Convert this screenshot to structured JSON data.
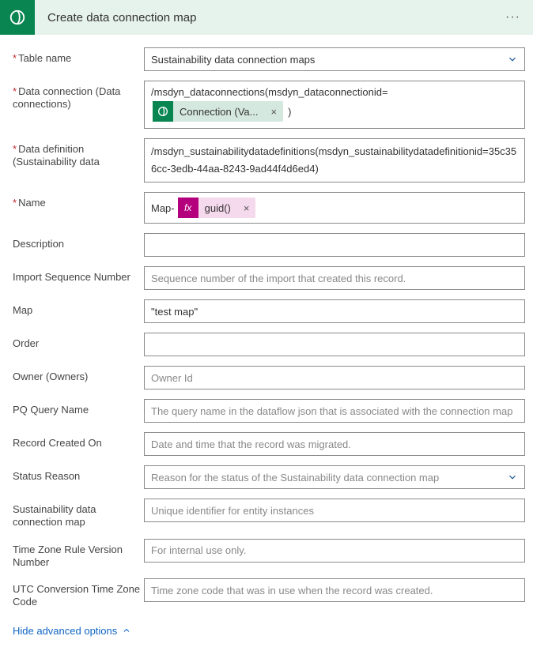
{
  "header": {
    "title": "Create data connection map"
  },
  "fields": {
    "table_name": {
      "label": "Table name",
      "value": "Sustainability data connection maps"
    },
    "data_connection": {
      "label": "Data connection (Data connections)",
      "prefix": "/msdyn_dataconnections(msdyn_dataconnectionid=",
      "chip": "Connection (Va...",
      "suffix": ")"
    },
    "data_definition": {
      "label": "Data definition (Sustainability data",
      "value": "/msdyn_sustainabilitydatadefinitions(msdyn_sustainabilitydatadefinitionid=35c356cc-3edb-44aa-8243-9ad44f4d6ed4)"
    },
    "name": {
      "label": "Name",
      "prefix": "Map-",
      "fx_label": "fx",
      "fx_value": "guid()"
    },
    "description": {
      "label": "Description",
      "value": ""
    },
    "import_seq": {
      "label": "Import Sequence Number",
      "placeholder": "Sequence number of the import that created this record."
    },
    "map": {
      "label": "Map",
      "value": "\"test map\""
    },
    "order": {
      "label": "Order",
      "value": ""
    },
    "owner": {
      "label": "Owner (Owners)",
      "placeholder": "Owner Id"
    },
    "pq_query": {
      "label": "PQ Query Name",
      "placeholder": "The query name in the dataflow json that is associated with the connection map"
    },
    "record_created": {
      "label": "Record Created On",
      "placeholder": "Date and time that the record was migrated."
    },
    "status_reason": {
      "label": "Status Reason",
      "placeholder": "Reason for the status of the Sustainability data connection map"
    },
    "scm": {
      "label": "Sustainability data connection map",
      "placeholder": "Unique identifier for entity instances"
    },
    "tz_rule": {
      "label": "Time Zone Rule Version Number",
      "placeholder": "For internal use only."
    },
    "utc_code": {
      "label": "UTC Conversion Time Zone Code",
      "placeholder": "Time zone code that was in use when the record was created."
    }
  },
  "footer": {
    "toggle": "Hide advanced options"
  }
}
